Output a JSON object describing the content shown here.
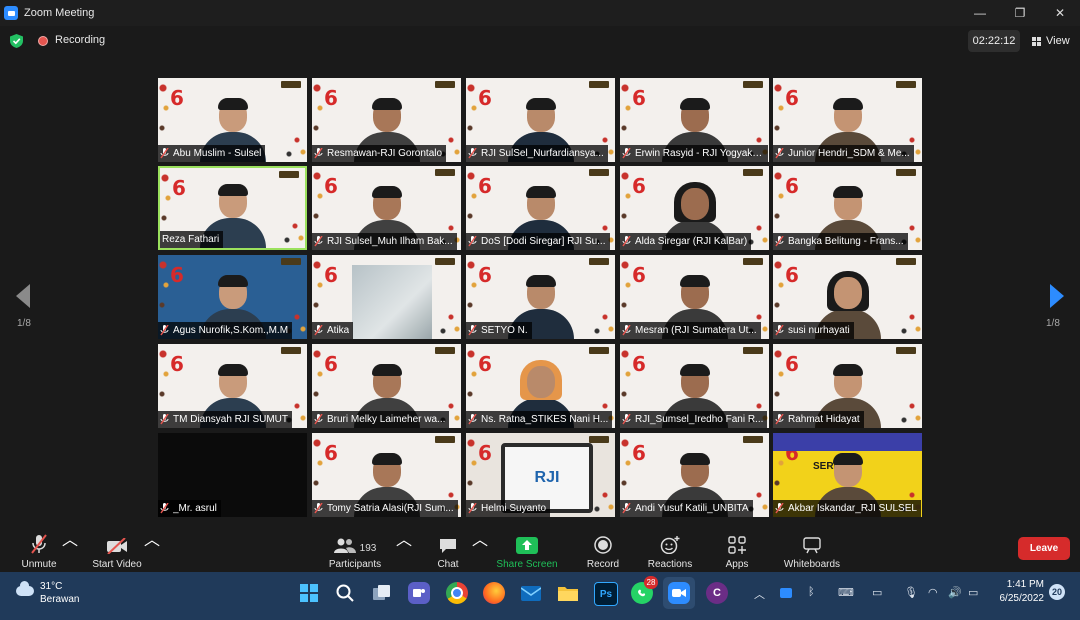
{
  "window": {
    "title": "Zoom Meeting",
    "minimize": "—",
    "maximize": "❐",
    "close": "✕"
  },
  "status": {
    "recording": "Recording",
    "timer": "02:22:12",
    "view": "View"
  },
  "gallery": {
    "page": "1/8",
    "participants": [
      "Abu Muslim - Sulsel",
      "Resmawan-RJI Gorontalo",
      "RJI SulSel_Nurfardiansya...",
      "Erwin Rasyid - RJI Yogyakarta",
      "Junior Hendri_SDM & Me...",
      "Reza Fathari",
      "RJI Sulsel_Muh Ilham Bak...",
      "DoS [Dodi Siregar] RJI Su...",
      "Alda Siregar (RJI KalBar)",
      "Bangka Belitung - Frans...",
      "Agus Nurofik,S.Kom.,M.M",
      "Atika",
      "SETYO N.",
      "Mesran (RJI Sumatera Ut...",
      "susi nurhayati",
      "TM Diansyah RJI SUMUT",
      "Bruri Melky Laimeher wa...",
      "Ns. Ratna_STIKES Nani H...",
      "RJI_Sumsel_Iredho Fani R...",
      "Rahmat Hidayat",
      "_Mr. asrul",
      "Tomy Satria Alasi(RJI Sum...",
      "Helmi Suyanto",
      "Andi Yusuf Katili_UNBITA",
      "Akbar Iskandar_RJI SULSEL"
    ],
    "background_number": "6",
    "rji_logo": "RJI",
    "banner_text": "SERIES"
  },
  "toolbar": {
    "unmute": "Unmute",
    "start_video": "Start Video",
    "participants": "Participants",
    "participants_count": "193",
    "chat": "Chat",
    "share_screen": "Share Screen",
    "record": "Record",
    "reactions": "Reactions",
    "apps": "Apps",
    "whiteboards": "Whiteboards",
    "leave": "Leave",
    "share_color": "#1fbf58",
    "leave_color": "#d62b2b"
  },
  "taskbar": {
    "temperature": "31°C",
    "weather": "Berawan",
    "whatsapp_badge": "28",
    "time": "1:41 PM",
    "date": "6/25/2022",
    "notifications": "20",
    "apps": [
      "windows-icon",
      "search-icon",
      "task-view-icon",
      "teams-icon",
      "chrome-icon",
      "firefox-icon",
      "mail-icon",
      "file-explorer-icon",
      "photoshop-icon",
      "whatsapp-icon",
      "zoom-icon",
      "app-icon"
    ],
    "photoshop_label": "Ps"
  }
}
